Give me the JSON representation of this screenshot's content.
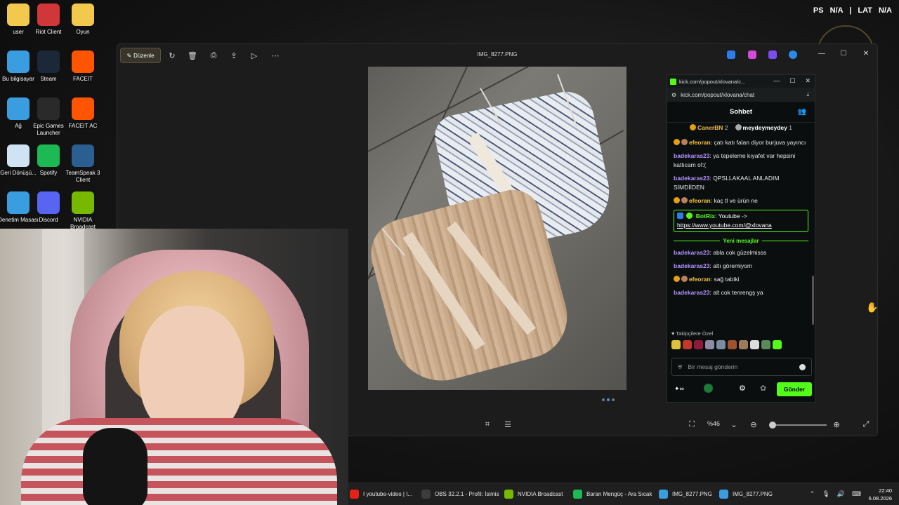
{
  "desktop": {
    "icons": [
      {
        "label": "user",
        "icon": "folder-icon",
        "color": "#f2c94c"
      },
      {
        "label": "Riot Client",
        "icon": "riot-client-icon",
        "color": "#d13639"
      },
      {
        "label": "Oyun",
        "icon": "folder-icon",
        "color": "#f2c94c"
      },
      {
        "label": "Bu bilgisayar",
        "icon": "monitor-icon",
        "color": "#3a9de0"
      },
      {
        "label": "Steam",
        "icon": "steam-icon",
        "color": "#1b2838"
      },
      {
        "label": "FACEIT",
        "icon": "faceit-icon",
        "color": "#ff5500"
      },
      {
        "label": "Ağ",
        "icon": "network-icon",
        "color": "#3a9de0"
      },
      {
        "label": "Epic Games Launcher",
        "icon": "epic-games-icon",
        "color": "#2a2a2a"
      },
      {
        "label": "FACEIT AC",
        "icon": "faceit-ac-icon",
        "color": "#ff5500"
      },
      {
        "label": "Geri Dönüşü...",
        "icon": "recycle-bin-icon",
        "color": "#cfe3f2"
      },
      {
        "label": "Spotify",
        "icon": "spotify-icon",
        "color": "#1db954"
      },
      {
        "label": "TeamSpeak 3 Client",
        "icon": "teamspeak-icon",
        "color": "#2b5f91"
      },
      {
        "label": "Denetim Masası",
        "icon": "control-panel-icon",
        "color": "#3a9de0"
      },
      {
        "label": "Discord",
        "icon": "discord-icon",
        "color": "#5865f2"
      },
      {
        "label": "NVIDIA Broadcast",
        "icon": "nvidia-broadcast-icon",
        "color": "#76b900"
      }
    ]
  },
  "hud": {
    "part1": "PS",
    "v1": "N/A",
    "part2": "LAT",
    "v2": "N/A"
  },
  "viewer": {
    "edit_label": "Düzenle",
    "title": "IMG_8277.PNG",
    "zoom": "%46",
    "accent": "#4a90e2"
  },
  "chat": {
    "window_title": "kick.com/popout/xlovana/c...",
    "url": "kick.com/popout/xlovana/chat",
    "header": "Sohbet",
    "pinned": [
      {
        "name": "CanerBN",
        "count": "2"
      },
      {
        "name": "meydeymeydey",
        "count": "1"
      }
    ],
    "messages": [
      {
        "user": "efeoran",
        "text": "çatı katı falan diyor burjuva yayıncı",
        "style": "u2",
        "badges": true
      },
      {
        "user": "badekaras23",
        "text": "ya tepeleme kıyafet var hepsini katlıcam of:(",
        "style": "u1",
        "badges": false
      },
      {
        "user": "badekaras23",
        "text": "QPSLLAKAAL ANLADIM SİMDİİDEN",
        "style": "u1",
        "badges": false
      },
      {
        "user": "efeoran",
        "text": "kaç tl ve ürün ne",
        "style": "u2",
        "badges": true
      }
    ],
    "bot": {
      "user": "BotRix",
      "text": "Youtube ->",
      "link": "https://www.youtube.com/@xlovana"
    },
    "new_messages_label": "Yeni mesajlar",
    "messages2": [
      {
        "user": "badekaras23",
        "text": "abla cok güzelmisss",
        "style": "u1",
        "badges": false
      },
      {
        "user": "badekaras23",
        "text": "altı göremiyom",
        "style": "u1",
        "badges": false
      },
      {
        "user": "efeoran",
        "text": "sağ tabiki",
        "style": "u2",
        "badges": true
      },
      {
        "user": "badekaras23",
        "text": "alt cok tenrengş ya",
        "style": "u1",
        "badges": false
      }
    ],
    "followers_label": "Takipçilere Özel",
    "input_placeholder": "Bir mesaj gönderin",
    "send_label": "Gönder",
    "brand_color": "#53fc18"
  },
  "taskbar": {
    "items": [
      {
        "label": "I youtube-video | I...",
        "icon": "youtube-icon",
        "color": "#e62117"
      },
      {
        "label": "OBS 32.2.1 - Profil: İsimis",
        "icon": "obs-icon",
        "color": "#3c3c3c"
      },
      {
        "label": "NVIDIA Broadcast",
        "icon": "nvidia-icon",
        "color": "#76b900"
      },
      {
        "label": "Baran Mengüç - Ara Sıcak",
        "icon": "spotify-icon",
        "color": "#1db954"
      },
      {
        "label": "IMG_8277.PNG",
        "icon": "photos-icon",
        "color": "#3a9de0"
      },
      {
        "label": "IMG_8277.PNG",
        "icon": "photos-icon",
        "color": "#3a9de0"
      }
    ],
    "time": "22:40",
    "date": "6.08.2026"
  }
}
